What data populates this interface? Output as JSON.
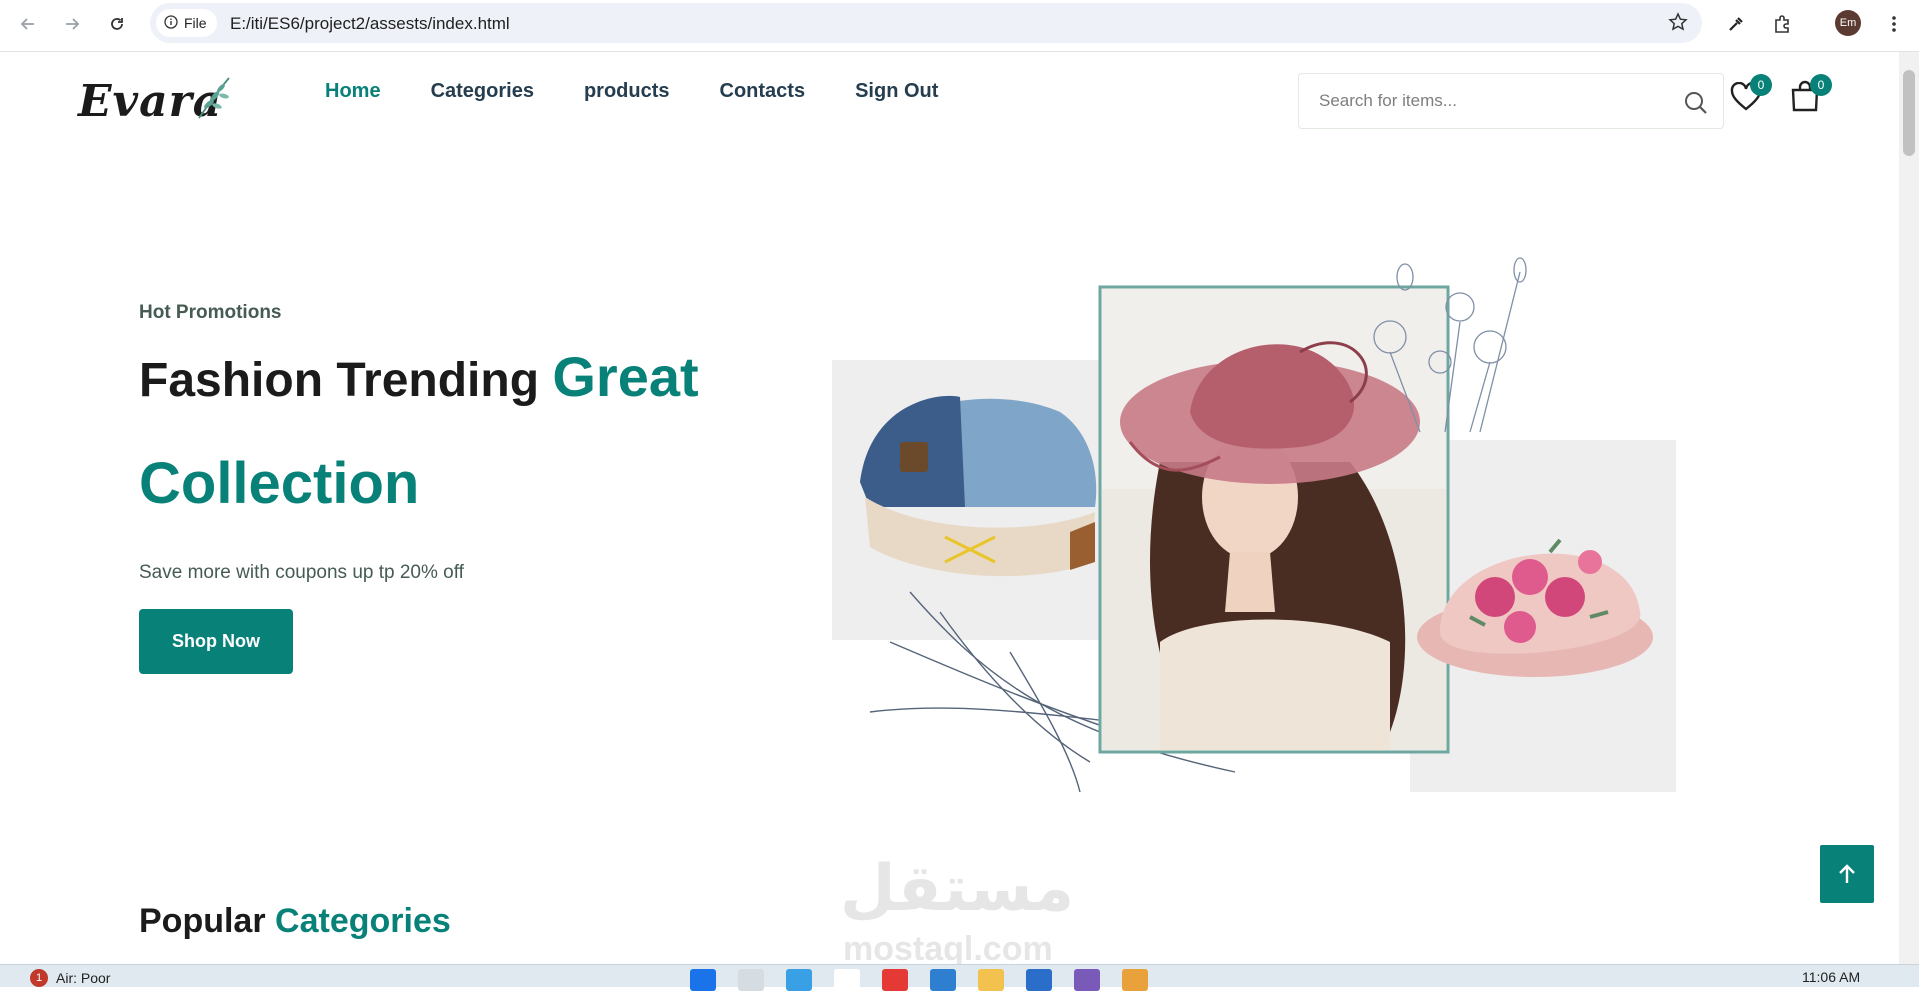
{
  "browser": {
    "site_chip": "File",
    "url": "E:/iti/ES6/project2/assests/index.html",
    "profile_initials": "Em",
    "icons": [
      "back-icon",
      "forward-icon",
      "reload-icon",
      "info-icon",
      "star-icon",
      "eyedropper-icon",
      "extensions-icon",
      "kebab-menu-icon"
    ]
  },
  "header": {
    "logo": "Evara",
    "menu": [
      {
        "label": "Home",
        "active": true
      },
      {
        "label": "Categories",
        "active": false
      },
      {
        "label": "products",
        "active": false
      },
      {
        "label": "Contacts",
        "active": false
      },
      {
        "label": "Sign Out",
        "active": false
      }
    ],
    "search_placeholder": "Search for items...",
    "wishlist_count": "0",
    "cart_count": "0"
  },
  "hero": {
    "eyebrow": "Hot Promotions",
    "title_dark": "Fashion Trending",
    "title_green_1": "Great",
    "title_green_2": "Collection",
    "subtitle": "Save more with coupons up tp 20% off",
    "cta": "Shop Now"
  },
  "section": {
    "title_dark": "Popular",
    "title_green": "Categories"
  },
  "watermark": {
    "arabic": "مستقل",
    "latin": "mostaql.com"
  },
  "taskbar": {
    "weather_badge": "1",
    "weather": "Air: Poor",
    "clock": "11:06 AM"
  },
  "colors": {
    "accent": "#088178",
    "heading": "#1b1b1b",
    "nav_text": "#253d4e"
  }
}
